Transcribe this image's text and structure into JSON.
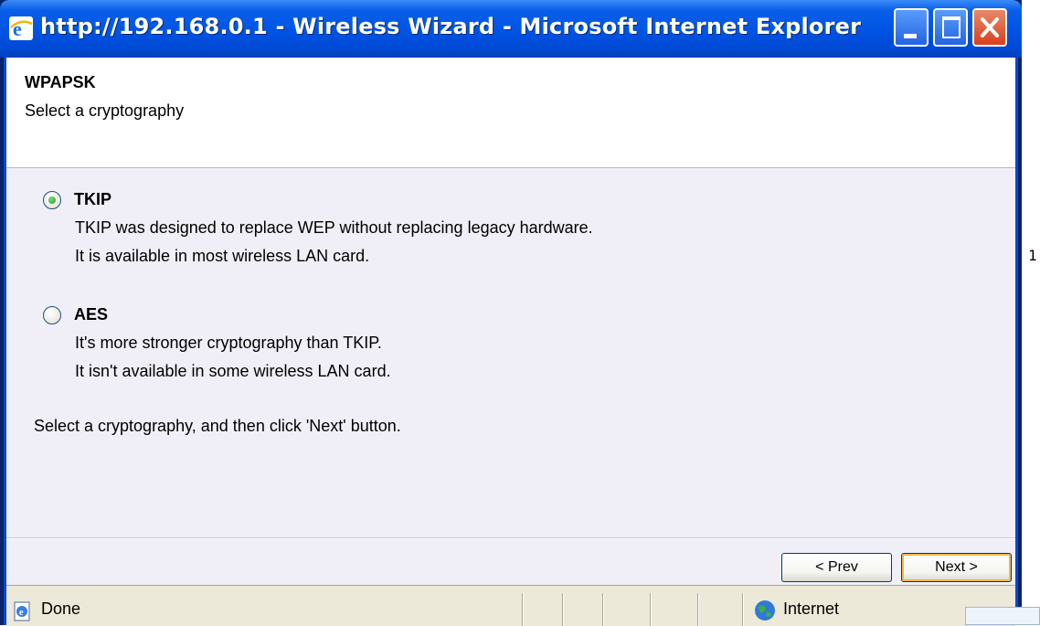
{
  "window": {
    "title": "http://192.168.0.1 - Wireless Wizard - Microsoft Internet Explorer",
    "icon": "ie-icon",
    "controls": [
      "minimize-button",
      "maximize-button",
      "close-button"
    ]
  },
  "header": {
    "title": "WPAPSK",
    "subtitle": "Select a cryptography"
  },
  "options": [
    {
      "label": "TKIP",
      "selected": true,
      "desc1": "TKIP was designed to replace WEP without replacing legacy hardware.",
      "desc2": "It is available in most wireless LAN card."
    },
    {
      "label": "AES",
      "selected": false,
      "desc1": "It's more stronger cryptography than TKIP.",
      "desc2": "It isn't available in some wireless LAN card."
    }
  ],
  "instruction": "Select a cryptography, and then click 'Next' button.",
  "buttons": {
    "prev": "< Prev",
    "next": "Next >"
  },
  "status": {
    "text": "Done",
    "zone": "Internet"
  },
  "side_glyph": "1,",
  "colors": {
    "titlebar": "#0055e5",
    "content_bg": "#f0eff7",
    "status_bg": "#ece9d8"
  }
}
